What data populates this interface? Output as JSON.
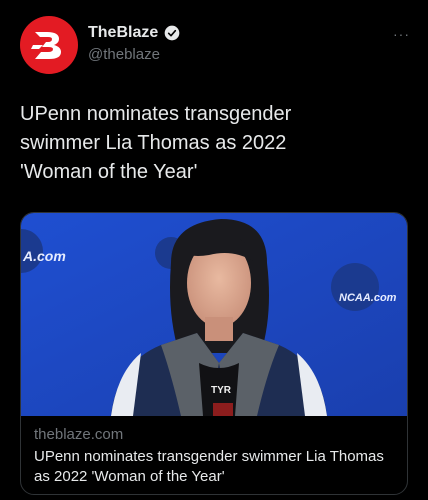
{
  "author": {
    "name": "TheBlaze",
    "handle": "@theblaze",
    "verified_color": "#1d9bf0",
    "avatar_color": "#e31b23"
  },
  "more_label": "···",
  "tweet": {
    "text": "UPenn nominates transgender\nswimmer Lia Thomas as 2022\n'Woman of the Year'"
  },
  "card": {
    "domain": "theblaze.com",
    "title": "UPenn nominates transgender swimmer Lia Thomas as 2022 'Woman of the Year'",
    "image_backdrop_left": "A.com",
    "image_backdrop_right": "NCAA.com",
    "jacket_logo": "TYR"
  },
  "icons": [
    "blaze-logo-icon",
    "verified-badge-icon",
    "more-options-icon"
  ]
}
